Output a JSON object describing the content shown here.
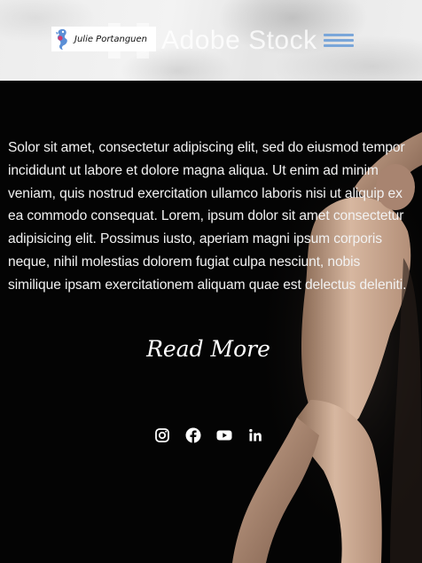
{
  "header": {
    "logo_text": "Julie Portanguen",
    "watermark_text": "Adobe Stock",
    "menu_icon": "hamburger-menu-icon",
    "menu_color": "#7aa6d9"
  },
  "main": {
    "body_text": "Solor sit amet, consectetur adipiscing elit, sed do eiusmod tempor incididunt ut labore et dolore magna aliqua. Ut enim ad minim veniam, quis nostrud exercitation ullamco laboris nisi ut aliquip ex ea commodo consequat. Lorem, ipsum dolor sit amet consectetur adipisicing elit. Possimus iusto, aperiam magni ipsum corporis neque, nihil molestias dolorem fugiat culpa nesciunt, nobis similique ipsam exercitationem aliquam quae est delectus deleniti.",
    "read_more_label": "Read More",
    "background_color": "#040404",
    "text_color": "#f2f2f2"
  },
  "social": [
    {
      "icon": "instagram-icon"
    },
    {
      "icon": "facebook-icon"
    },
    {
      "icon": "youtube-icon"
    },
    {
      "icon": "linkedin-icon"
    }
  ]
}
